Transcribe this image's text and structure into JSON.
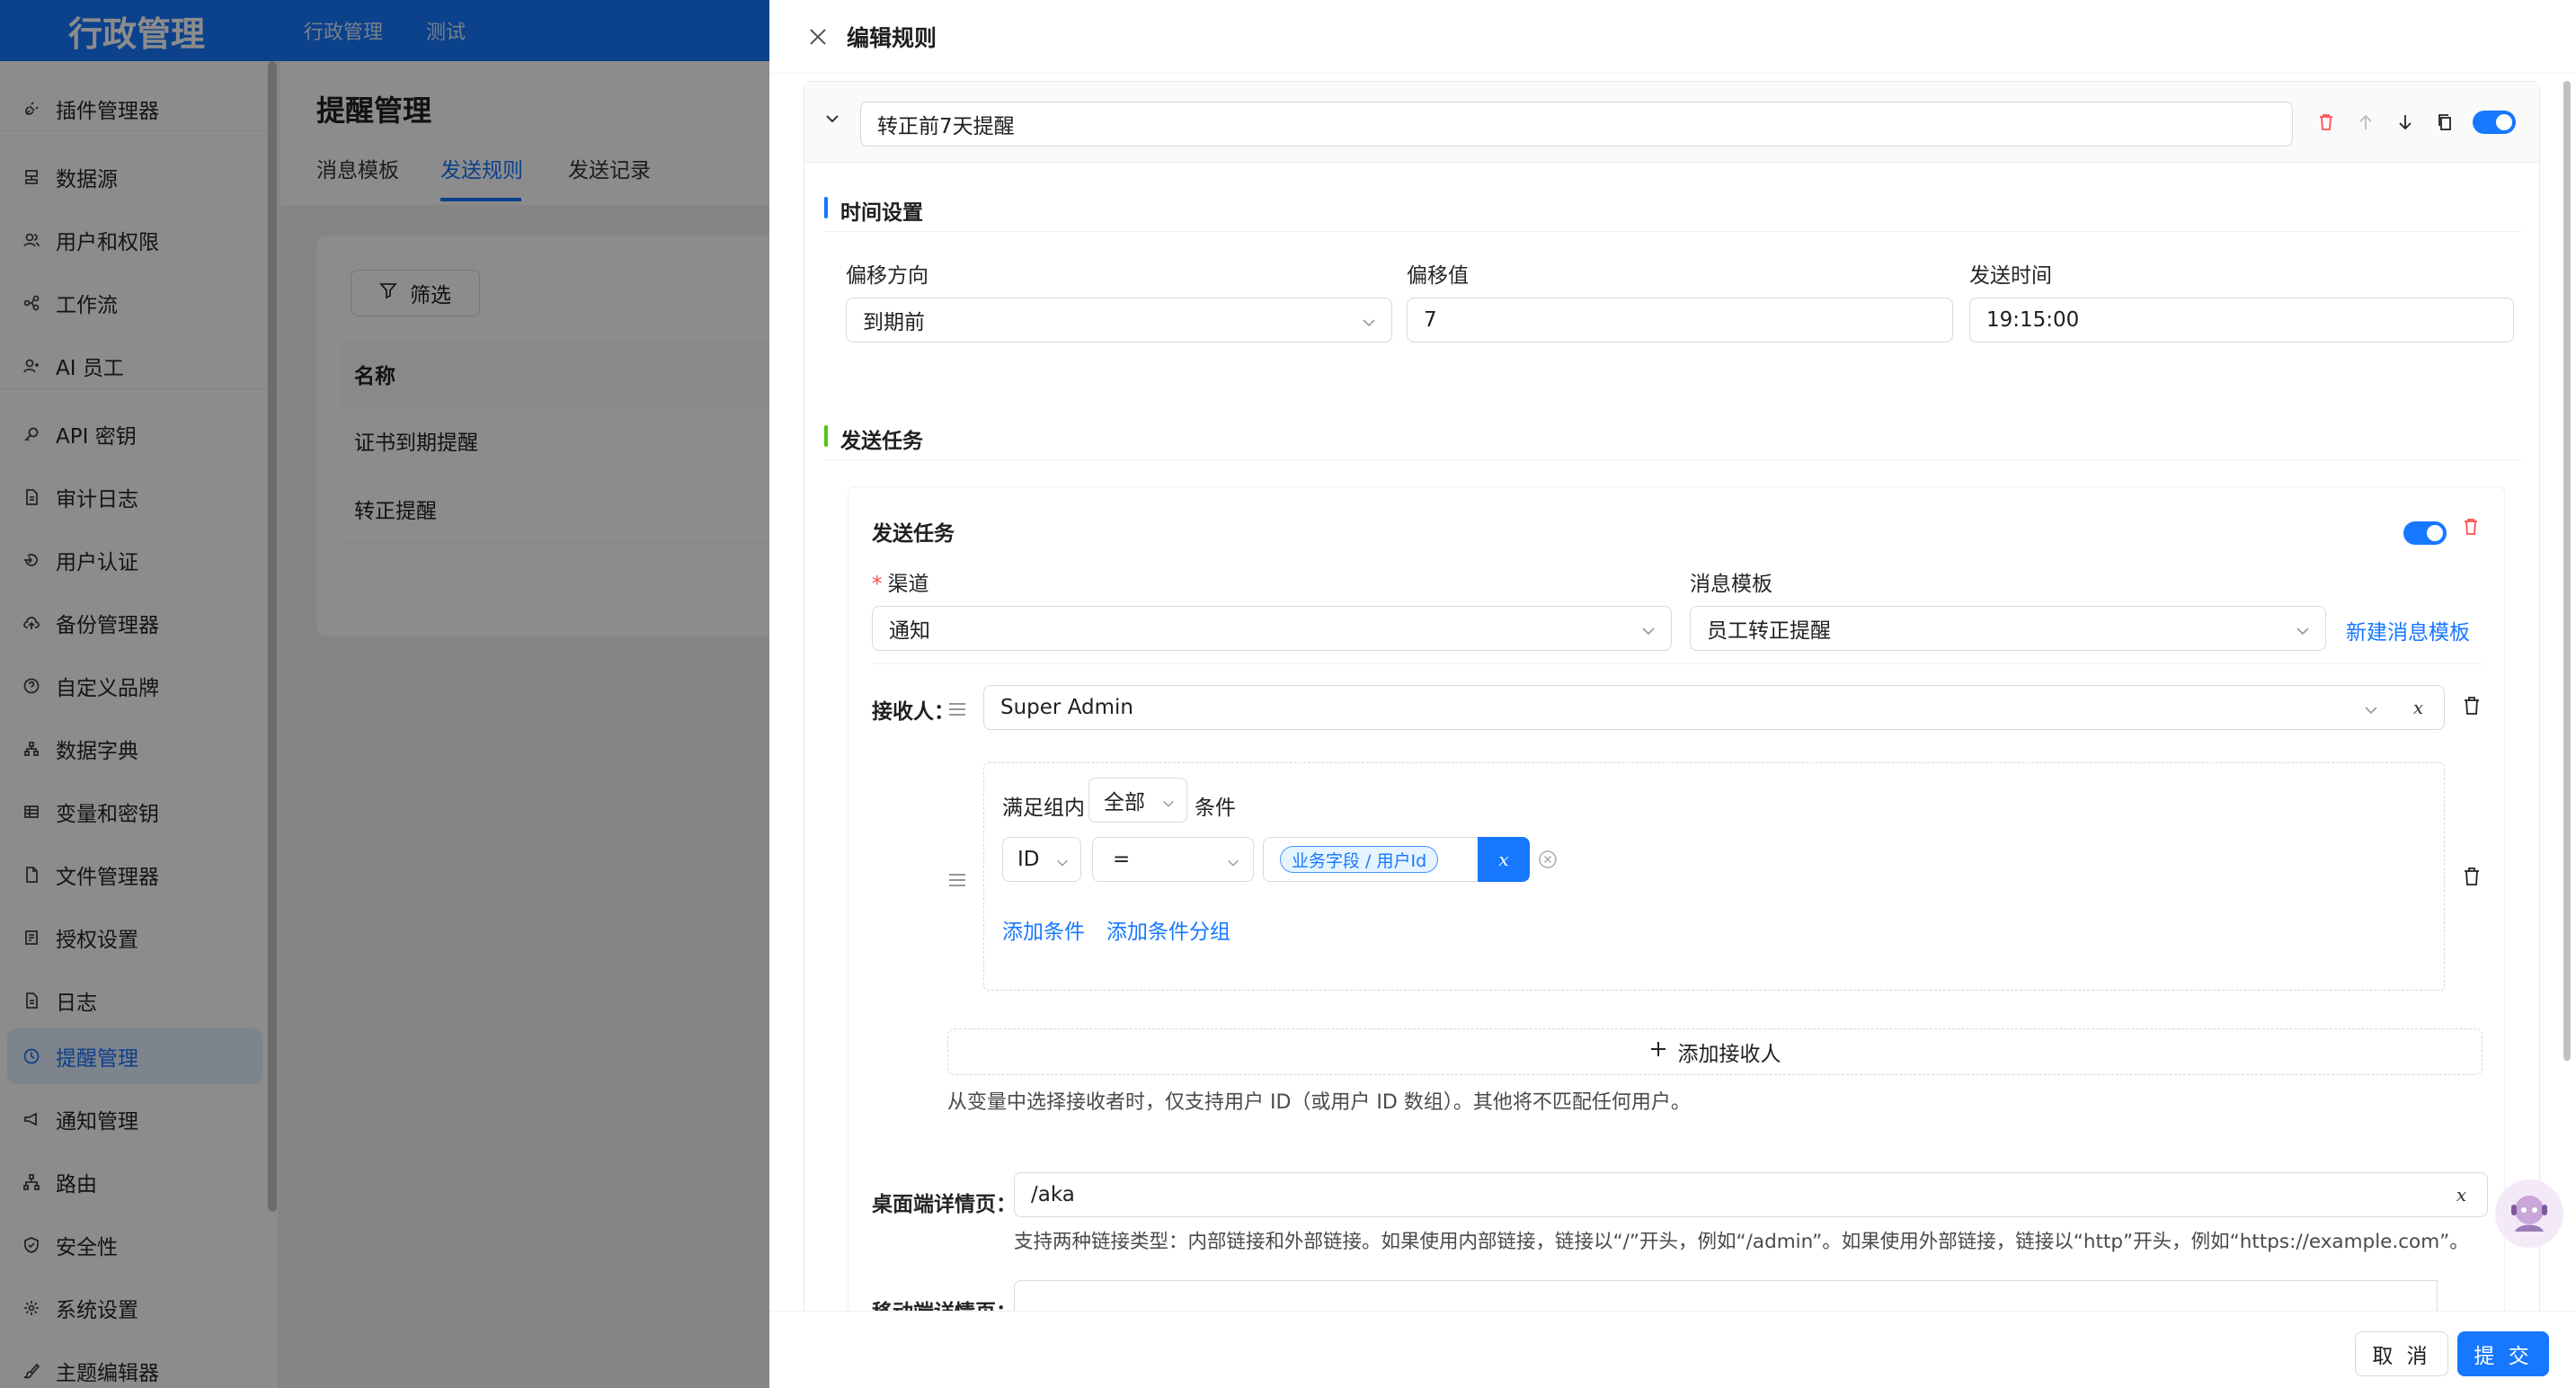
{
  "app": {
    "title": "行政管理",
    "nav": [
      "行政管理",
      "测试"
    ]
  },
  "sidebar": {
    "items": [
      {
        "label": "插件管理器",
        "icon": "plug-icon"
      },
      {
        "label": "数据源",
        "icon": "database-icon"
      },
      {
        "label": "用户和权限",
        "icon": "users-icon"
      },
      {
        "label": "工作流",
        "icon": "workflow-icon"
      },
      {
        "label": "AI 员工",
        "icon": "ai-employee-icon"
      },
      {
        "label": "API 密钥",
        "icon": "key-icon"
      },
      {
        "label": "审计日志",
        "icon": "audit-log-icon"
      },
      {
        "label": "用户认证",
        "icon": "login-icon"
      },
      {
        "label": "备份管理器",
        "icon": "cloud-backup-icon"
      },
      {
        "label": "自定义品牌",
        "icon": "question-circle-icon"
      },
      {
        "label": "数据字典",
        "icon": "tree-icon"
      },
      {
        "label": "变量和密钥",
        "icon": "table-icon"
      },
      {
        "label": "文件管理器",
        "icon": "file-icon"
      },
      {
        "label": "授权设置",
        "icon": "license-icon"
      },
      {
        "label": "日志",
        "icon": "log-icon"
      },
      {
        "label": "提醒管理",
        "icon": "clock-icon",
        "active": true
      },
      {
        "label": "通知管理",
        "icon": "notification-icon"
      },
      {
        "label": "路由",
        "icon": "route-icon"
      },
      {
        "label": "安全性",
        "icon": "shield-icon"
      },
      {
        "label": "系统设置",
        "icon": "gear-icon"
      },
      {
        "label": "主题编辑器",
        "icon": "brush-icon"
      }
    ]
  },
  "page": {
    "title": "提醒管理",
    "tabs": [
      "消息模板",
      "发送规则",
      "发送记录"
    ],
    "active_tab": "发送规则",
    "filter_label": "筛选",
    "table_header": "名称",
    "rows": [
      "证书到期提醒",
      "转正提醒"
    ]
  },
  "drawer": {
    "title": "编辑规则",
    "rule_name": "转正前7天提醒",
    "time_section": {
      "title": "时间设置",
      "offset_direction_label": "偏移方向",
      "offset_direction_value": "到期前",
      "offset_value_label": "偏移值",
      "offset_value": "7",
      "send_time_label": "发送时间",
      "send_time_value": "19:15:00"
    },
    "task_section": {
      "title": "发送任务",
      "card_title": "发送任务",
      "channel_label": "渠道",
      "channel_value": "通知",
      "template_label": "消息模板",
      "template_value": "员工转正提醒",
      "new_template_link": "新建消息模板",
      "recipient_label": "接收人：",
      "recipient_value": "Super Admin",
      "var_button": "x",
      "condition": {
        "prefix": "满足组内",
        "scope": "全部",
        "suffix": "条件",
        "field": "ID",
        "operator": "=",
        "value_tag": "业务字段 / 用户Id",
        "add_condition": "添加条件",
        "add_group": "添加条件分组"
      },
      "add_recipient": "添加接收人",
      "recipient_hint": "从变量中选择接收者时，仅支持用户 ID（或用户 ID 数组）。其他将不匹配任何用户。",
      "desktop_label": "桌面端详情页：",
      "desktop_value": "/aka",
      "desktop_hint": "支持两种链接类型：内部链接和外部链接。如果使用内部链接，链接以“/”开头，例如“/admin”。如果使用外部链接，链接以“http”开头，例如“https://example.com”。",
      "mobile_label": "移动端详情页："
    },
    "footer": {
      "cancel": "取 消",
      "submit": "提 交"
    }
  },
  "colors": {
    "primary": "#1677ff",
    "danger": "#ff4d4f",
    "success": "#52c41a"
  }
}
